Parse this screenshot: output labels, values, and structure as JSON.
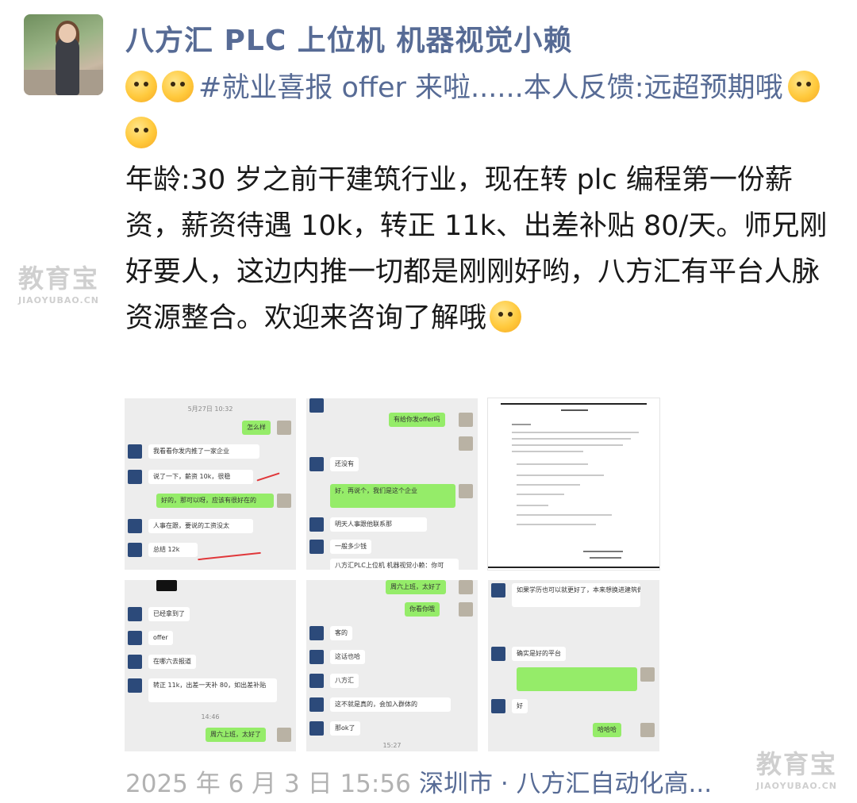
{
  "author": {
    "name": "八方汇 PLC 上位机 机器视觉小赖"
  },
  "post": {
    "tag": "#就业喜报 offer 来啦......本人反馈:远超预期哦",
    "body": "年龄:30 岁之前干建筑行业，现在转 plc 编程第一份薪资，薪资待遇 10k，转正 11k、出差补贴 80/天。师兄刚好要人，这边内推一切都是刚刚好哟，八方汇有平台人脉资源整合。欢迎来咨询了解哦"
  },
  "images": [
    {
      "ts": "5月27日 10:32",
      "msgs": [
        "怎么样",
        "我看看你发内推了一家企业",
        "说了一下，薪资 10k，很稳",
        "好的，那可以呀，应该有很好在的",
        "人事在跟，要说的工资没太",
        "总结 12k"
      ]
    },
    {
      "msgs": [
        "有给你发offer吗",
        "还没有",
        "好，再说个，我们是这个企业",
        "明天人事跟他联系那",
        "一般多少钱",
        "八方汇PLC上位机 机器视觉小赖：你可"
      ]
    },
    {
      "doc": true
    },
    {
      "msgs": [
        "已经拿到了",
        "offer",
        "在哪六去报道",
        "转正 11k，出差一天补 80，如出差补贴",
        "周六上班，太好了"
      ],
      "ts": "14:46"
    },
    {
      "msgs": [
        "周六上班，太好了",
        "你看你哦",
        "客的",
        "这话也哈",
        "八方汇",
        "这不就是真的，会加入群体的",
        "那ok了"
      ],
      "ts": "15:27"
    },
    {
      "msgs": [
        "如果学历也可以就更好了，本来想换进建筑做不下去的，不好找",
        "确实是好的平台",
        "好",
        "哈哈哈"
      ]
    }
  ],
  "footer": {
    "time": "2025 年 6 月 3 日 15:56",
    "location": "深圳市 · 八方汇自动化高..."
  },
  "watermark": {
    "title": "教育宝",
    "sub": "JIAOYUBAO.CN"
  }
}
